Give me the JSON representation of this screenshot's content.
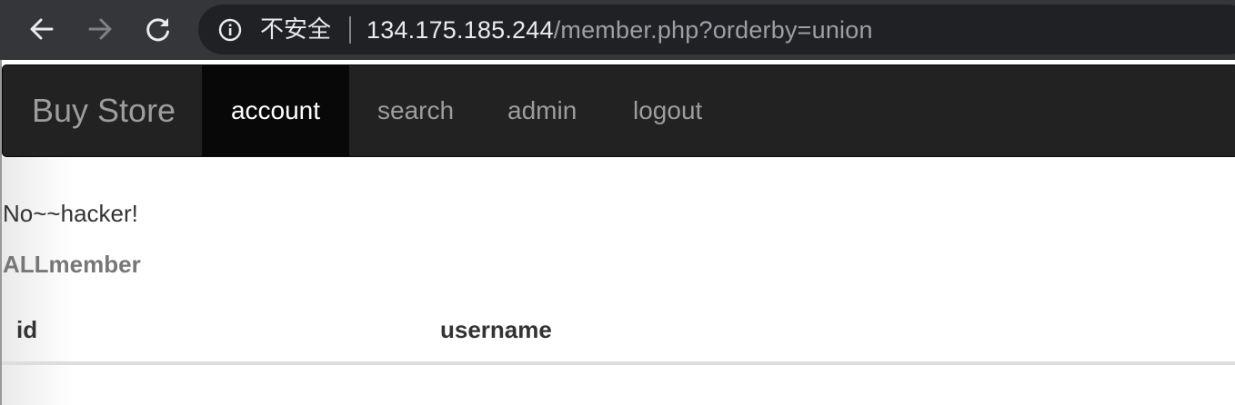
{
  "browser": {
    "security_label": "不安全",
    "url_host": "134.175.185.244",
    "url_path": "/member.php?orderby=union"
  },
  "navbar": {
    "brand": "Buy Store",
    "items": [
      {
        "label": "account",
        "active": true
      },
      {
        "label": "search",
        "active": false
      },
      {
        "label": "admin",
        "active": false
      },
      {
        "label": "logout",
        "active": false
      }
    ]
  },
  "main": {
    "message": "No~~hacker!",
    "heading": "ALLmember",
    "table": {
      "columns": [
        "id",
        "username"
      ],
      "rows": []
    }
  },
  "colors": {
    "chrome_bg": "#35363a",
    "omnibox_bg": "#202124",
    "navbar_bg": "#222222",
    "active_bg": "#080808",
    "nav_text": "#9d9d9d"
  }
}
